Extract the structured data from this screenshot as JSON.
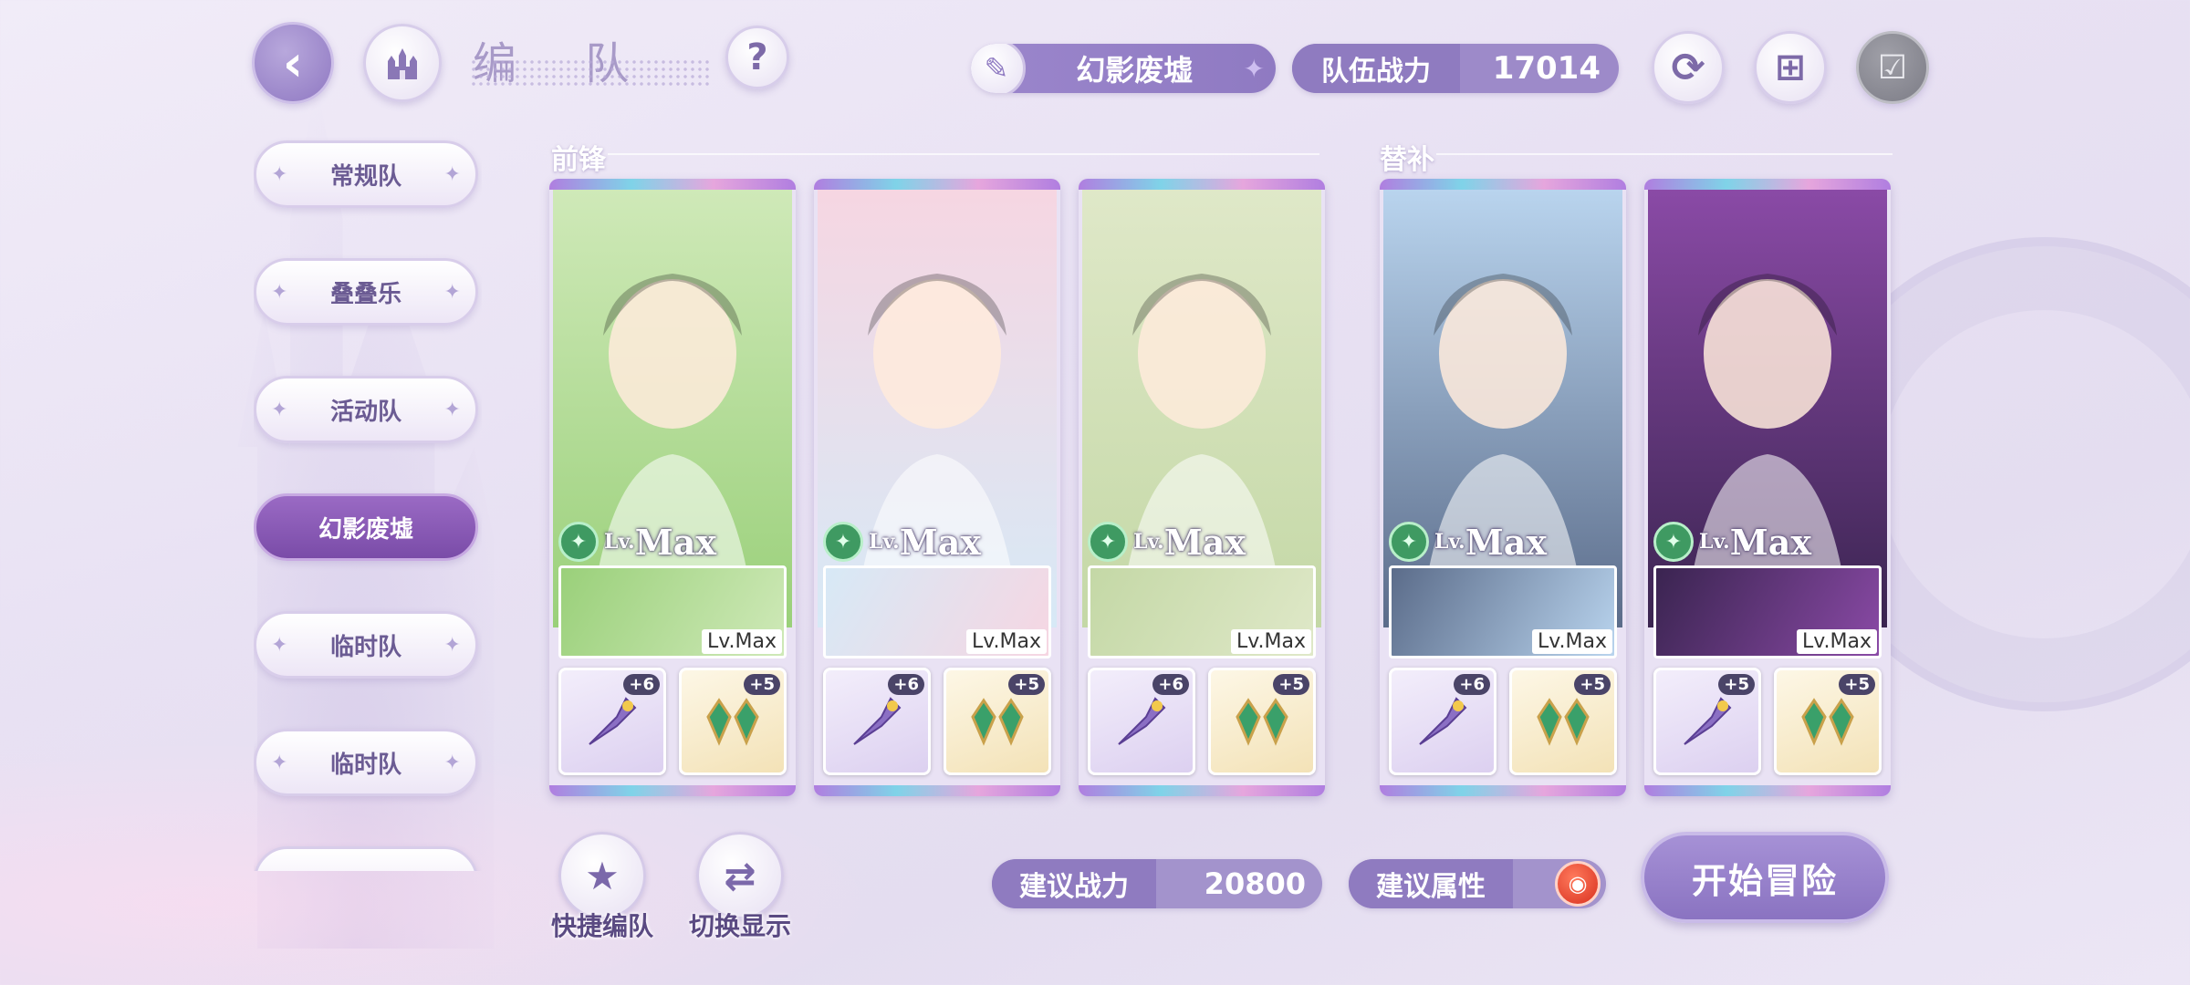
{
  "header": {
    "title": "编 队",
    "back_icon": "back-arrow-icon",
    "home_icon": "castle-icon",
    "help_label": "?",
    "stage": {
      "name": "幻影废墟",
      "icon": "feather-icon"
    },
    "team_power": {
      "label": "队伍战力",
      "value": "17014"
    },
    "refresh_icon": "refresh-icon",
    "copy_icon": "copy-plus-icon",
    "check_icon": "checklist-icon"
  },
  "sidebar": {
    "items": [
      {
        "label": "常规队",
        "active": false
      },
      {
        "label": "叠叠乐",
        "active": false
      },
      {
        "label": "活动队",
        "active": false
      },
      {
        "label": "幻影废墟",
        "active": true
      },
      {
        "label": "临时队",
        "active": false
      },
      {
        "label": "临时队",
        "active": false
      }
    ]
  },
  "sections": {
    "front": "前锋",
    "sub": "替补"
  },
  "cards": [
    {
      "level": "Max",
      "lv_prefix": "Lv.",
      "sub_level": "Lv.Max",
      "equip1_plus": "+6",
      "equip2_plus": "+5",
      "palette": [
        "#cfe9b8",
        "#9ad07a"
      ]
    },
    {
      "level": "Max",
      "lv_prefix": "Lv.",
      "sub_level": "Lv.Max",
      "equip1_plus": "+6",
      "equip2_plus": "+5",
      "palette": [
        "#f6d6e2",
        "#d7e9f6"
      ]
    },
    {
      "level": "Max",
      "lv_prefix": "Lv.",
      "sub_level": "Lv.Max",
      "equip1_plus": "+6",
      "equip2_plus": "+5",
      "palette": [
        "#dfe8c8",
        "#c4d8a6"
      ]
    },
    {
      "level": "Max",
      "lv_prefix": "Lv.",
      "sub_level": "Lv.Max",
      "equip1_plus": "+6",
      "equip2_plus": "+5",
      "palette": [
        "#b9d4ee",
        "#5b6c8a"
      ]
    },
    {
      "level": "Max",
      "lv_prefix": "Lv.",
      "sub_level": "Lv.Max",
      "equip1_plus": "+5",
      "equip2_plus": "+5",
      "palette": [
        "#8a4aa6",
        "#3a2450"
      ]
    }
  ],
  "bottom": {
    "quick_team": "快捷编队",
    "switch_display": "切换显示",
    "suggest_power": {
      "label": "建议战力",
      "value": "20800"
    },
    "suggest_attr": {
      "label": "建议属性",
      "icon": "fire-element-icon"
    },
    "start": "开始冒险"
  }
}
